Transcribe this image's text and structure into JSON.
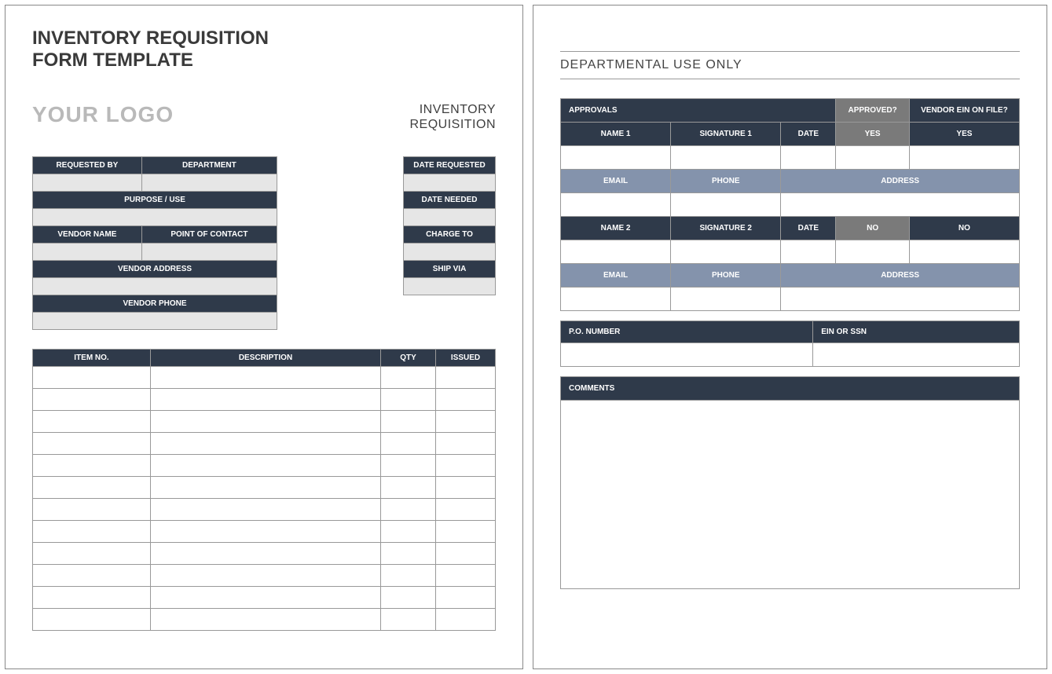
{
  "title_line1": "INVENTORY REQUISITION",
  "title_line2": "FORM TEMPLATE",
  "logo_text": "YOUR LOGO",
  "subtitle_line1": "INVENTORY",
  "subtitle_line2": "REQUISITION",
  "left_labels": {
    "requested_by": "REQUESTED BY",
    "department": "DEPARTMENT",
    "purpose_use": "PURPOSE / USE",
    "vendor_name": "VENDOR NAME",
    "point_of_contact": "POINT OF CONTACT",
    "vendor_address": "VENDOR ADDRESS",
    "vendor_phone": "VENDOR PHONE"
  },
  "right_labels": {
    "date_requested": "DATE REQUESTED",
    "date_needed": "DATE NEEDED",
    "charge_to": "CHARGE TO",
    "ship_via": "SHIP VIA"
  },
  "items_table": {
    "headers": {
      "item_no": "ITEM NO.",
      "description": "DESCRIPTION",
      "qty": "QTY",
      "issued": "ISSUED"
    },
    "row_count": 12
  },
  "section_title": "DEPARTMENTAL USE ONLY",
  "approvals": {
    "approvals_label": "APPROVALS",
    "approved_label": "APPROVED?",
    "vendor_ein_label": "VENDOR EIN ON FILE?",
    "name1": "NAME 1",
    "signature1": "SIGNATURE 1",
    "date": "DATE",
    "yes": "YES",
    "name2": "NAME 2",
    "signature2": "SIGNATURE 2",
    "no": "NO",
    "email": "EMAIL",
    "phone": "PHONE",
    "address": "ADDRESS"
  },
  "po": {
    "po_number": "P.O. NUMBER",
    "ein_or_ssn": "EIN OR SSN"
  },
  "comments_label": "COMMENTS"
}
